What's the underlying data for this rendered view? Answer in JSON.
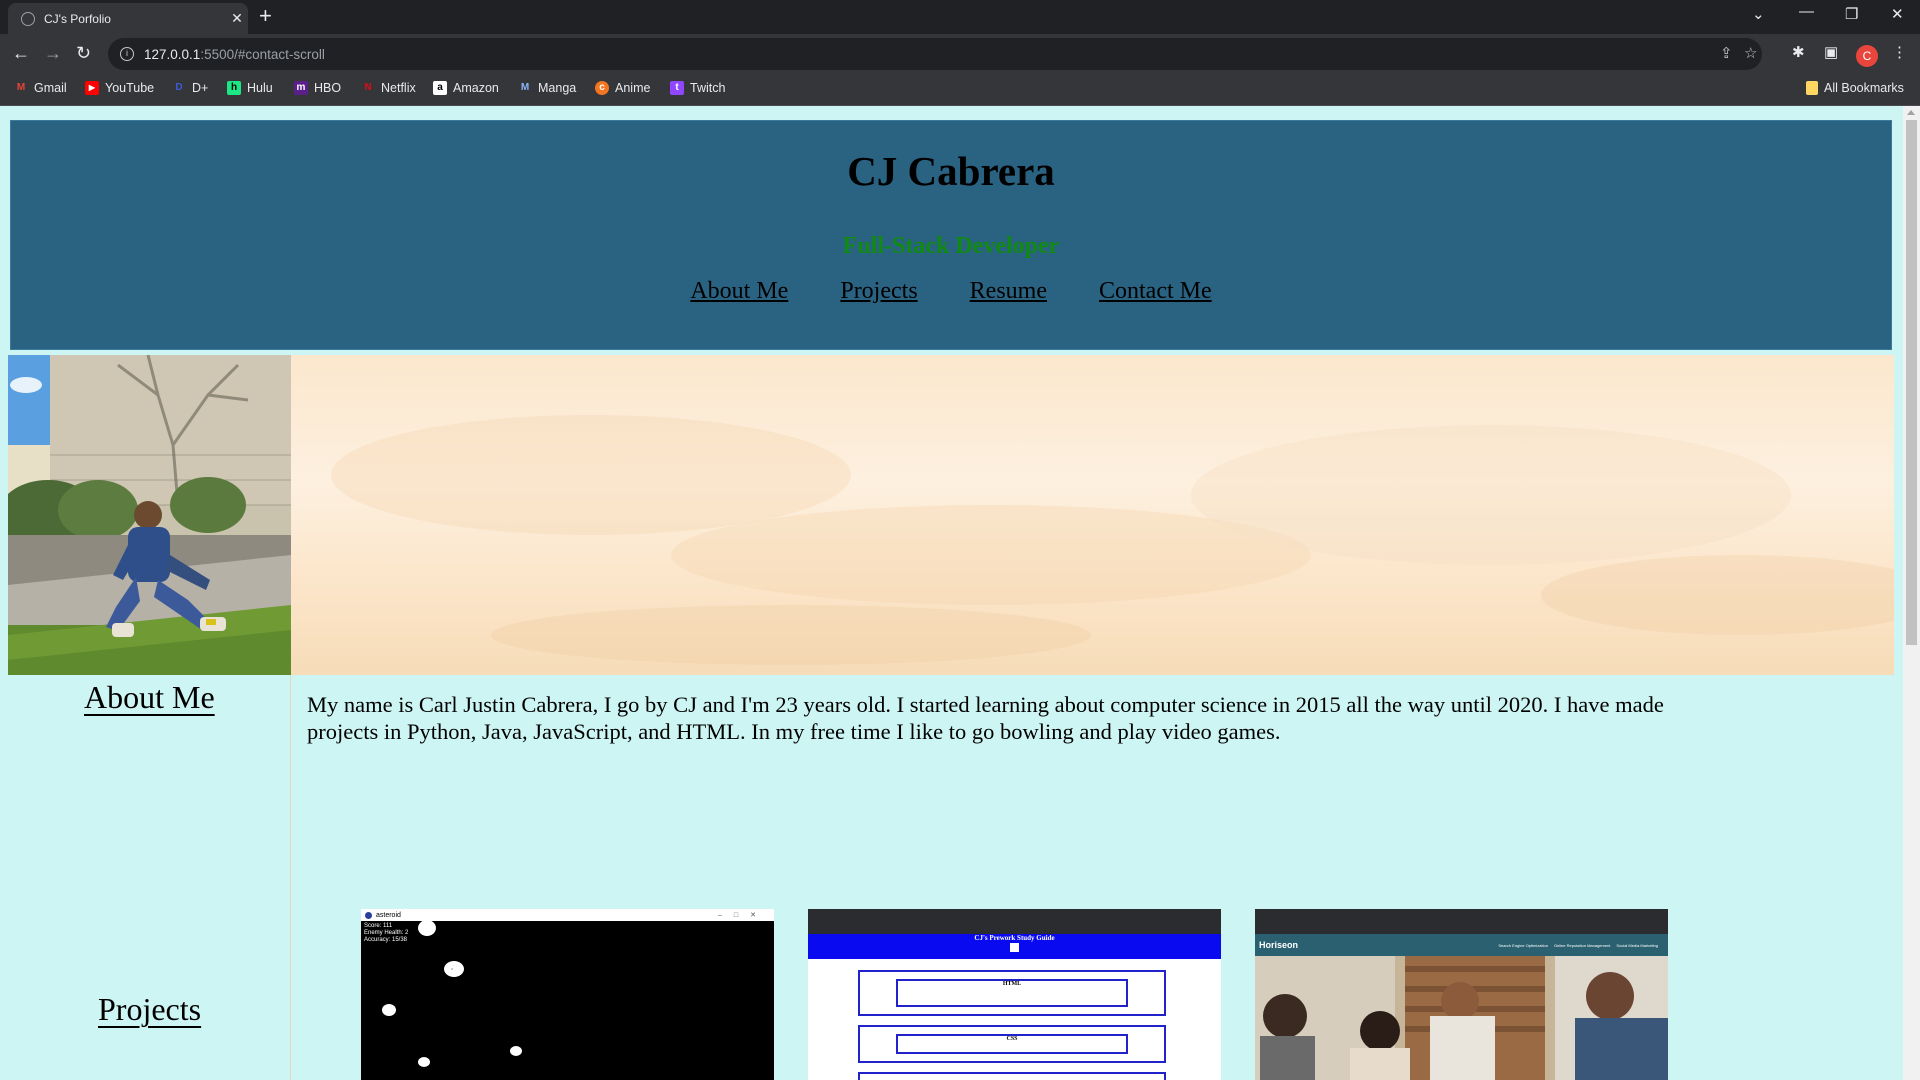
{
  "browser": {
    "tab_title": "CJ's Porfolio",
    "url_host": "127.0.0.1",
    "url_path": ":5500/#contact-scroll",
    "profile_initial": "C",
    "bookmarks": [
      "Gmail",
      "YouTube",
      "D+",
      "Hulu",
      "HBO",
      "Netflix",
      "Amazon",
      "Manga",
      "Anime",
      "Twitch"
    ],
    "all_bookmarks_label": "All Bookmarks"
  },
  "page": {
    "name": "CJ Cabrera",
    "subtitle": "Full-Stack Developer",
    "nav": [
      "About Me",
      "Projects",
      "Resume",
      "Contact Me"
    ],
    "about_heading": "About Me",
    "about_text": "My name is Carl Justin Cabrera, I go by CJ and I'm 23 years old. I started learning about computer science in 2015 all the way until 2020. I have made projects in Python, Java, JavaScript, and HTML. In my free time I like to go bowling and play video games.",
    "projects_heading": "Projects",
    "projects": [
      {
        "window_title": "asteroid",
        "stats": [
          "Score: 111",
          "Enemy Health: 2",
          "Accuracy: 15/38"
        ]
      },
      {
        "page_title": "CJ's Prework Study Guide",
        "sections": [
          "HTML",
          "CSS"
        ]
      },
      {
        "brand": "Horiseon",
        "links": [
          "Search Engine Optimization",
          "Online Reputation Management",
          "Social Media Marketing"
        ]
      }
    ]
  },
  "colors": {
    "header_bg": "#2a6282",
    "subtitle": "#118a14",
    "page_bg": "#cdf5f3",
    "paper": "#fbe7cd"
  }
}
